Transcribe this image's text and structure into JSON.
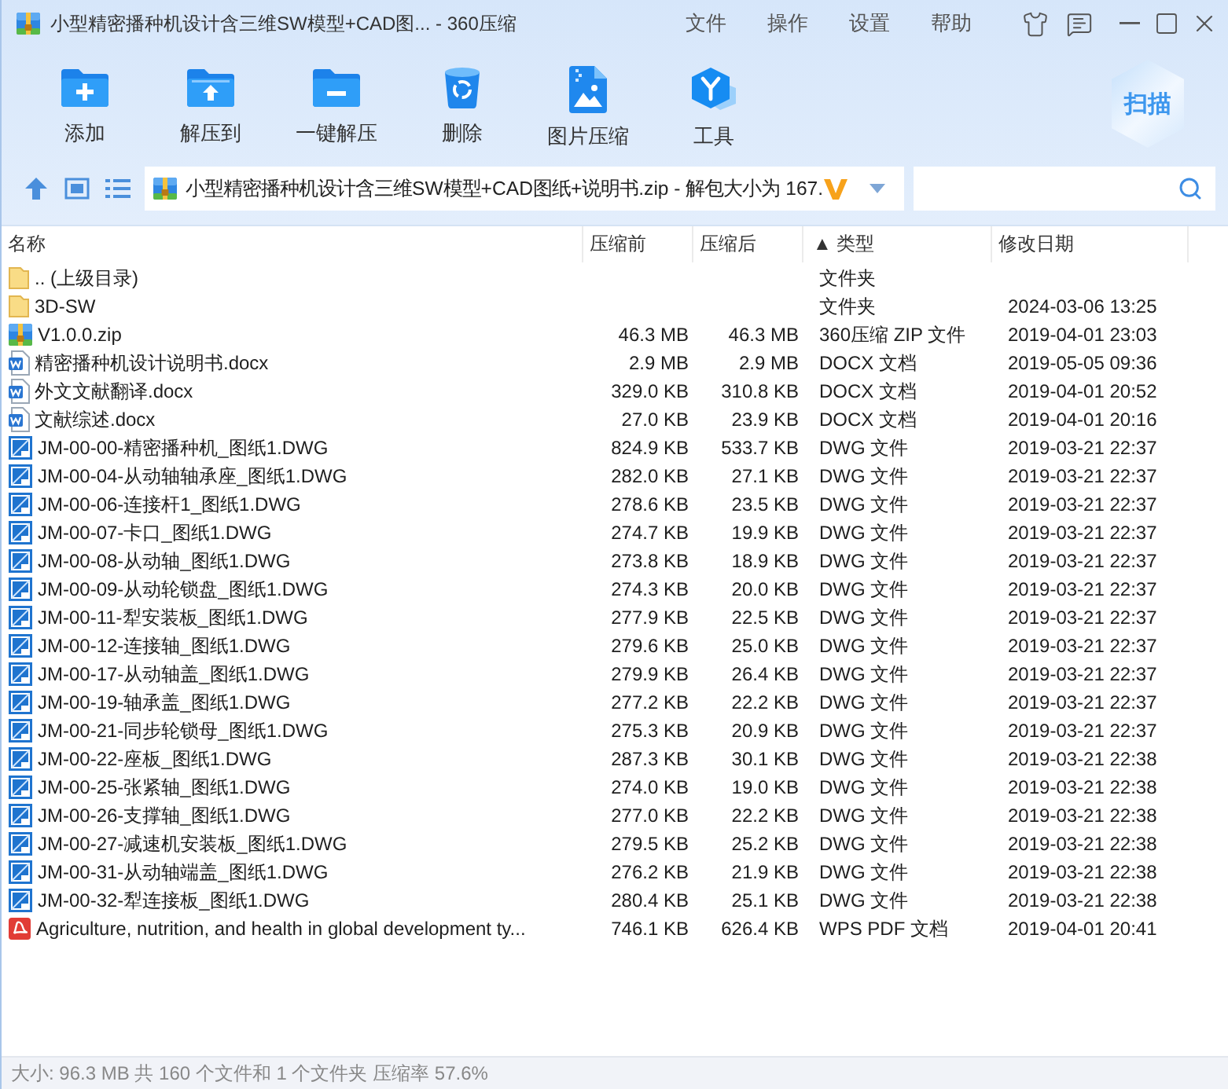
{
  "window": {
    "title": "小型精密播种机设计含三维SW模型+CAD图... - 360压缩"
  },
  "menu": [
    "文件",
    "操作",
    "设置",
    "帮助"
  ],
  "toolbar": [
    {
      "kind": "add",
      "label": "添加"
    },
    {
      "kind": "extract",
      "label": "解压到"
    },
    {
      "kind": "quick_extract",
      "label": "一键解压"
    },
    {
      "kind": "delete",
      "label": "删除"
    },
    {
      "kind": "image",
      "label": "图片压缩"
    },
    {
      "kind": "tools",
      "label": "工具"
    }
  ],
  "scan_button": {
    "label": "扫描"
  },
  "address_bar": {
    "path": "小型精密播种机设计含三维SW模型+CAD图纸+说明书.zip - 解包大小为 167."
  },
  "table": {
    "columns": [
      {
        "label": "名称"
      },
      {
        "label": "压缩前"
      },
      {
        "label": "压缩后"
      },
      {
        "label": "▲ 类型"
      },
      {
        "label": "修改日期"
      }
    ],
    "rows": [
      {
        "kind": "folder",
        "name": ".. (上级目录)",
        "type": "文件夹"
      },
      {
        "kind": "folder",
        "name": "3D-SW",
        "type": "文件夹",
        "modified": "2024-03-06 13:25"
      },
      {
        "kind": "zip",
        "name": "V1.0.0.zip",
        "size": "46.3 MB",
        "packed": "46.3 MB",
        "type": "360压缩 ZIP 文件",
        "modified": "2019-04-01 23:03"
      },
      {
        "kind": "docx",
        "name": "精密播种机设计说明书.docx",
        "size": "2.9 MB",
        "packed": "2.9 MB",
        "type": "DOCX 文档",
        "modified": "2019-05-05 09:36"
      },
      {
        "kind": "docx",
        "name": "外文文献翻译.docx",
        "size": "329.0 KB",
        "packed": "310.8 KB",
        "type": "DOCX 文档",
        "modified": "2019-04-01 20:52"
      },
      {
        "kind": "docx",
        "name": "文献综述.docx",
        "size": "27.0 KB",
        "packed": "23.9 KB",
        "type": "DOCX 文档",
        "modified": "2019-04-01 20:16"
      },
      {
        "kind": "dwg",
        "name": "JM-00-00-精密播种机_图纸1.DWG",
        "size": "824.9 KB",
        "packed": "533.7 KB",
        "type": "DWG 文件",
        "modified": "2019-03-21 22:37"
      },
      {
        "kind": "dwg",
        "name": "JM-00-04-从动轴轴承座_图纸1.DWG",
        "size": "282.0 KB",
        "packed": "27.1 KB",
        "type": "DWG 文件",
        "modified": "2019-03-21 22:37"
      },
      {
        "kind": "dwg",
        "name": "JM-00-06-连接杆1_图纸1.DWG",
        "size": "278.6 KB",
        "packed": "23.5 KB",
        "type": "DWG 文件",
        "modified": "2019-03-21 22:37"
      },
      {
        "kind": "dwg",
        "name": "JM-00-07-卡口_图纸1.DWG",
        "size": "274.7 KB",
        "packed": "19.9 KB",
        "type": "DWG 文件",
        "modified": "2019-03-21 22:37"
      },
      {
        "kind": "dwg",
        "name": "JM-00-08-从动轴_图纸1.DWG",
        "size": "273.8 KB",
        "packed": "18.9 KB",
        "type": "DWG 文件",
        "modified": "2019-03-21 22:37"
      },
      {
        "kind": "dwg",
        "name": "JM-00-09-从动轮锁盘_图纸1.DWG",
        "size": "274.3 KB",
        "packed": "20.0 KB",
        "type": "DWG 文件",
        "modified": "2019-03-21 22:37"
      },
      {
        "kind": "dwg",
        "name": "JM-00-11-犁安装板_图纸1.DWG",
        "size": "277.9 KB",
        "packed": "22.5 KB",
        "type": "DWG 文件",
        "modified": "2019-03-21 22:37"
      },
      {
        "kind": "dwg",
        "name": "JM-00-12-连接轴_图纸1.DWG",
        "size": "279.6 KB",
        "packed": "25.0 KB",
        "type": "DWG 文件",
        "modified": "2019-03-21 22:37"
      },
      {
        "kind": "dwg",
        "name": "JM-00-17-从动轴盖_图纸1.DWG",
        "size": "279.9 KB",
        "packed": "26.4 KB",
        "type": "DWG 文件",
        "modified": "2019-03-21 22:37"
      },
      {
        "kind": "dwg",
        "name": "JM-00-19-轴承盖_图纸1.DWG",
        "size": "277.2 KB",
        "packed": "22.2 KB",
        "type": "DWG 文件",
        "modified": "2019-03-21 22:37"
      },
      {
        "kind": "dwg",
        "name": "JM-00-21-同步轮锁母_图纸1.DWG",
        "size": "275.3 KB",
        "packed": "20.9 KB",
        "type": "DWG 文件",
        "modified": "2019-03-21 22:37"
      },
      {
        "kind": "dwg",
        "name": "JM-00-22-座板_图纸1.DWG",
        "size": "287.3 KB",
        "packed": "30.1 KB",
        "type": "DWG 文件",
        "modified": "2019-03-21 22:38"
      },
      {
        "kind": "dwg",
        "name": "JM-00-25-张紧轴_图纸1.DWG",
        "size": "274.0 KB",
        "packed": "19.0 KB",
        "type": "DWG 文件",
        "modified": "2019-03-21 22:38"
      },
      {
        "kind": "dwg",
        "name": "JM-00-26-支撑轴_图纸1.DWG",
        "size": "277.0 KB",
        "packed": "22.2 KB",
        "type": "DWG 文件",
        "modified": "2019-03-21 22:38"
      },
      {
        "kind": "dwg",
        "name": "JM-00-27-减速机安装板_图纸1.DWG",
        "size": "279.5 KB",
        "packed": "25.2 KB",
        "type": "DWG 文件",
        "modified": "2019-03-21 22:38"
      },
      {
        "kind": "dwg",
        "name": "JM-00-31-从动轴端盖_图纸1.DWG",
        "size": "276.2 KB",
        "packed": "21.9 KB",
        "type": "DWG 文件",
        "modified": "2019-03-21 22:38"
      },
      {
        "kind": "dwg",
        "name": "JM-00-32-犁连接板_图纸1.DWG",
        "size": "280.4 KB",
        "packed": "25.1 KB",
        "type": "DWG 文件",
        "modified": "2019-03-21 22:38"
      },
      {
        "kind": "pdf",
        "name": "Agriculture, nutrition, and health in global development ty...",
        "size": "746.1 KB",
        "packed": "626.4 KB",
        "type": "WPS PDF 文档",
        "modified": "2019-04-01 20:41"
      }
    ]
  },
  "status_bar": "大小: 96.3 MB 共 160 个文件和 1 个文件夹 压缩率 57.6%"
}
